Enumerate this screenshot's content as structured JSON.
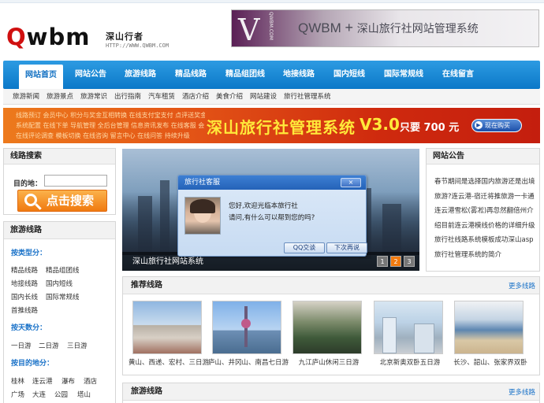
{
  "logo": {
    "brand_q": "Q",
    "brand_rest": "wbm",
    "tagline": "深山行者",
    "url": "HTTP://WWW.QWBM.COM"
  },
  "top_banner": {
    "v_mark": "V",
    "side_url": "QWBM.COM",
    "brand": "QWBM",
    "plus": "+",
    "text": "深山旅行社网站管理系统"
  },
  "nav": {
    "items": [
      "网站首页",
      "网站公告",
      "旅游线路",
      "精品线路",
      "精品组团线",
      "地接线路",
      "国内短线",
      "国际常规线",
      "在线留言"
    ]
  },
  "subnav": {
    "items": [
      "旅游新闻",
      "旅游景点",
      "旅游常识",
      "出行指南",
      "汽车租赁",
      "酒店介绍",
      "美食介绍",
      "网站建设",
      "旅行社管理系统"
    ]
  },
  "promo": {
    "lines": [
      "线路预订 会员中心 积分与奖金互相转换 在线支付宝支付 点评送奖金 奖金提现 点评送积分 广告资源",
      "系统配置 在线下单 导航管理 全后台管理 信息资讯发布 在线客服 会员订单 积分兑换 在线留言",
      "在线评论调查 模板切换 在线咨询 留言中心 在线问答 持续升级"
    ],
    "title": "深山旅行社管理系统",
    "version": "V3.0",
    "price": "只要 700 元",
    "buy_label": "现在购买"
  },
  "search": {
    "title": "线路搜索",
    "dest_label": "目的地：",
    "dest_value": "",
    "button_label": "点击搜索"
  },
  "routes": {
    "title": "旅游线路",
    "categories": [
      {
        "title": "按类型分：",
        "links": [
          "精品线路",
          "精品组团线",
          "地接线路",
          "国内短线",
          "国内长线",
          "国际常规线",
          "首推线路"
        ]
      },
      {
        "title": "按天数分：",
        "links": [
          "一日游",
          "二日游",
          "三日游"
        ]
      },
      {
        "title": "按目的地分：",
        "links": [
          "桂林",
          "连云港",
          "瀑布",
          "酒店",
          "广场",
          "大连",
          "公园",
          "塔山"
        ]
      }
    ]
  },
  "slideshow": {
    "caption": "深山旅行社网站系统",
    "pages": [
      "1",
      "2",
      "3"
    ],
    "active_page": "2"
  },
  "chat": {
    "title": "旅行社客服",
    "close": "×",
    "msg1": "您好,欢迎光临本旅行社",
    "msg2": "请问,有什么可以帮到您的吗?",
    "qq_button": "QQ交谈",
    "later_button": "下次再说"
  },
  "notice": {
    "title": "网站公告",
    "body": "春节期间是选择国内旅游还是出境旅游?连云港-宿迁将推旅游一卡通连云港雪松(雾凇)再忽然翻倍州介绍目前连云港模线价格的详细升级旅行社线路系统模板成功深山asp旅行社管理系统的简介"
  },
  "recommended": {
    "title": "推荐线路",
    "more": "更多线路",
    "items": [
      {
        "caption": "黄山、西递、宏村、三日游",
        "icon": "building-photo"
      },
      {
        "caption": "庐山、井冈山、南昌七日游",
        "icon": "tower-photo"
      },
      {
        "caption": "九江庐山休闲三日游",
        "icon": "bridge-photo"
      },
      {
        "caption": "北京新奥双卧五日游",
        "icon": "city-photo"
      },
      {
        "caption": "长沙、韶山、张家界双卧",
        "icon": "beach-photo"
      }
    ]
  },
  "routes2": {
    "title": "旅游线路",
    "more": "更多线路"
  },
  "colors": {
    "nav_blue": "#0b78c8",
    "accent_orange": "#f07a10",
    "link_blue": "#1a72c8",
    "promo_yellow": "#ffe93a"
  }
}
